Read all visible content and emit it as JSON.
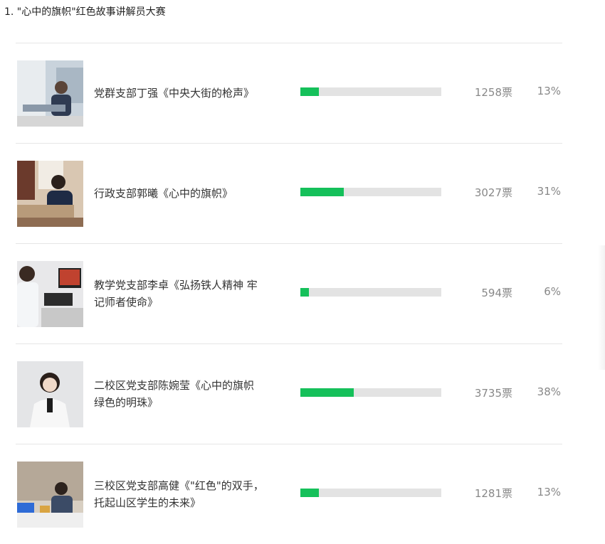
{
  "question": {
    "title": "1. \"心中的旗帜\"红色故事讲解员大赛"
  },
  "items": [
    {
      "name": "党群支部丁强《中央大街的枪声》",
      "votes": "1258票",
      "percent": "13%",
      "fraction": 0.13,
      "photo_icon": "person-at-desk-photo"
    },
    {
      "name": "行政支部郭曦《心中的旗帜》",
      "votes": "3027票",
      "percent": "31%",
      "fraction": 0.31,
      "photo_icon": "person-reading-photo"
    },
    {
      "name": "教学党支部李卓《弘扬铁人精神 牢记师者使命》",
      "votes": "594票",
      "percent": "6%",
      "fraction": 0.06,
      "photo_icon": "person-at-computer-photo"
    },
    {
      "name": "二校区党支部陈婉莹《心中的旗帜 绿色的明珠》",
      "votes": "3735票",
      "percent": "38%",
      "fraction": 0.38,
      "photo_icon": "portrait-photo"
    },
    {
      "name": "三校区党支部高健《\"红色\"的双手，托起山区学生的未来》",
      "votes": "1281票",
      "percent": "13%",
      "fraction": 0.13,
      "photo_icon": "person-seated-photo"
    }
  ],
  "colors": {
    "bar_fill": "#15c05a",
    "bar_track": "#e3e3e3",
    "text_muted": "#888888"
  }
}
